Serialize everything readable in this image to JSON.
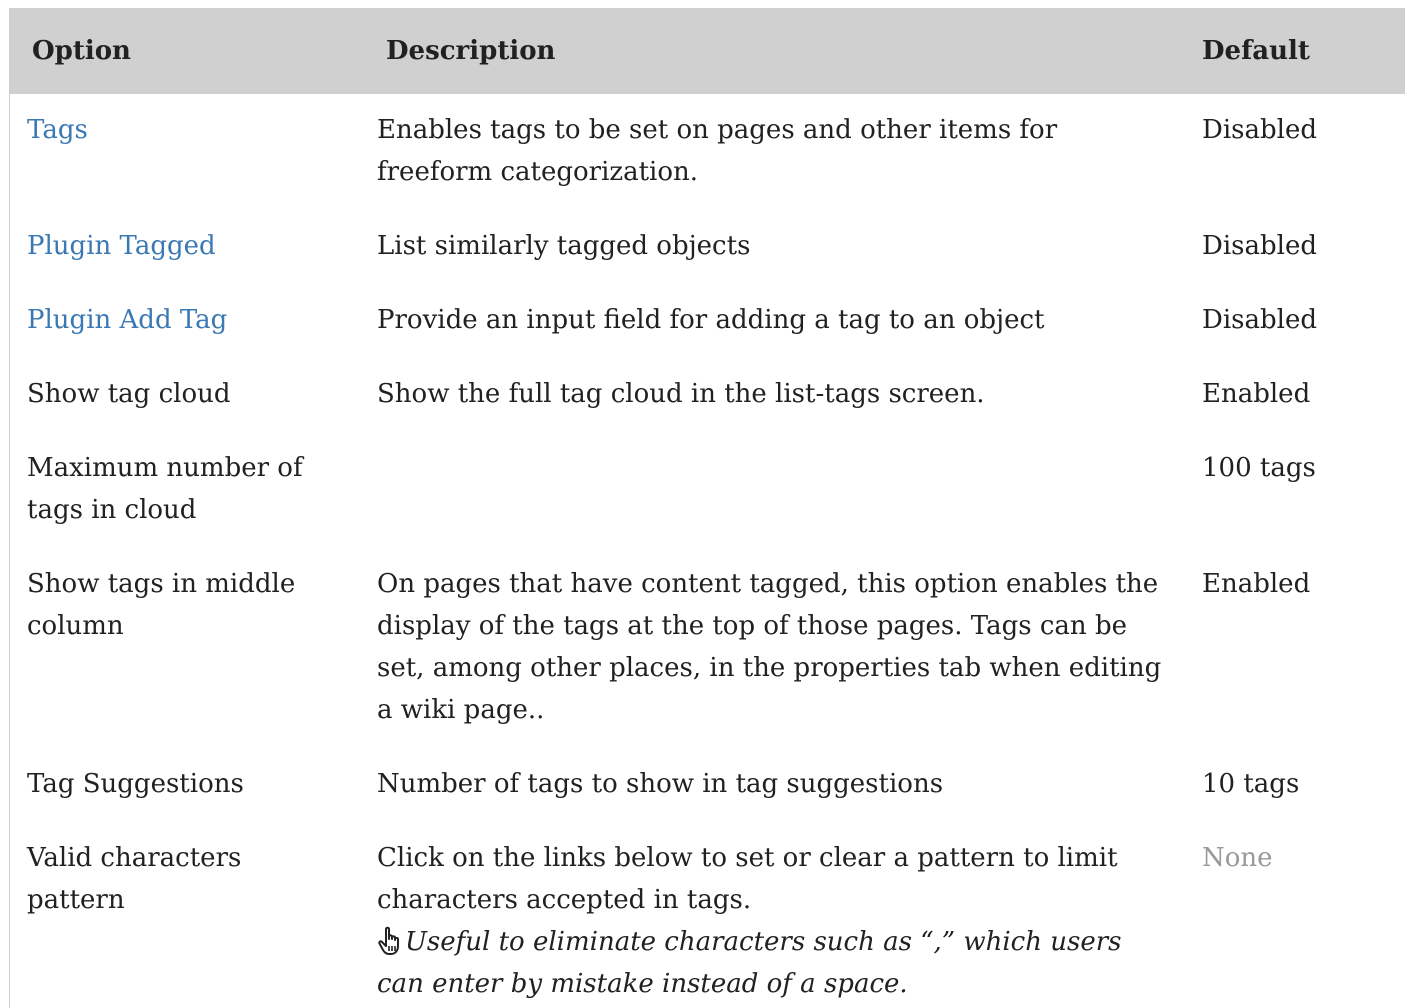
{
  "headers": {
    "option": "Option",
    "description": "Description",
    "default": "Default"
  },
  "rows": [
    {
      "option": "Tags",
      "description": "Enables tags to be set on pages and other items for freeform categorization.",
      "default": "Disabled"
    },
    {
      "option": "Plugin Tagged",
      "description": "List similarly tagged objects",
      "default": "Disabled"
    },
    {
      "option": "Plugin Add Tag",
      "description": "Provide an input field for adding a tag to an object",
      "default": "Disabled"
    },
    {
      "option": "Show tag cloud",
      "description": "Show the full tag cloud in the list-tags screen.",
      "default": "Enabled"
    },
    {
      "option": "Maximum number of tags in cloud",
      "description": "",
      "default": "100 tags"
    },
    {
      "option": "Show tags in middle column",
      "description": "On pages that have content tagged, this option enables the display of the tags at the top of those pages. Tags can be set, among other places, in the properties tab when editing a wiki page..",
      "default": "Enabled"
    },
    {
      "option": "Tag Suggestions",
      "description": "Number of tags to show in tag suggestions",
      "default": "10 tags"
    },
    {
      "option": "Valid characters pattern",
      "description": "Click on the links below to set or clear a pattern to limit characters accepted in tags.",
      "tip": "Useful to eliminate characters such as “,” which users can enter by mistake instead of a space.",
      "tip_icon": "pointing-hand-icon",
      "default": "None"
    }
  ],
  "colors": {
    "header_bg": "#d0d0d0",
    "link": "#3a79b3",
    "text": "#212121",
    "muted": "#999999"
  }
}
